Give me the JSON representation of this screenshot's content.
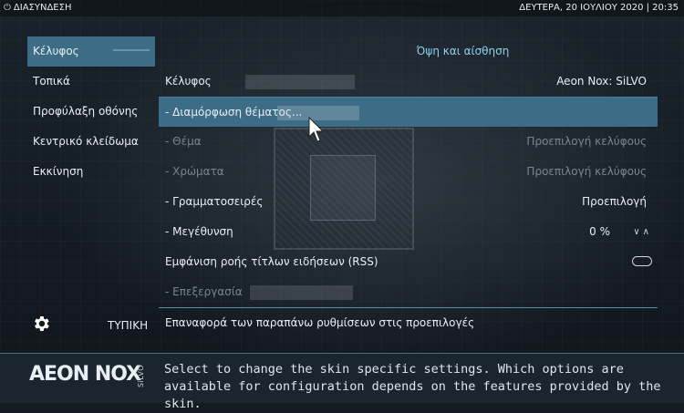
{
  "topbar": {
    "left_label": "ΔΙΑΣΥΝΔΕΣΗ",
    "datetime": "ΔΕΥΤΕΡΑ, 20 ΙΟΥΛΙΟΥ 2020 | 20:35"
  },
  "menu": {
    "items": [
      {
        "label": "Κέλυφος",
        "active": true
      },
      {
        "label": "Τοπικά"
      },
      {
        "label": "Προφύλαξη οθόνης"
      },
      {
        "label": "Κεντρικό κλείδωμα"
      },
      {
        "label": "Εκκίνηση"
      }
    ]
  },
  "panel": {
    "title": "Όψη και αίσθηση",
    "rows": [
      {
        "label": "Κέλυφος",
        "value": "Aeon Nox: SiLVO"
      },
      {
        "label": "- Διαμόρφωση θέματος..."
      },
      {
        "label": "- Θέμα",
        "value": "Προεπιλογή κελύφους"
      },
      {
        "label": "- Χρώματα",
        "value": "Προεπιλογή κελύφους"
      },
      {
        "label": "- Γραμματοσειρές",
        "value": "Προεπιλογή"
      },
      {
        "label": "- Μεγέθυνση",
        "value": "0 %",
        "arrows": "∨∧"
      },
      {
        "label": "Εμφάνιση ροής τίτλων ειδήσεων (RSS)"
      },
      {
        "label": "- Επεξεργασία"
      }
    ],
    "reset_label": "Επαναφορά των παραπάνω ρυθμίσεων στις προεπιλογές"
  },
  "bottom_left": {
    "icon": "gear-icon",
    "level_label": "ΤΥΠΙΚΗ"
  },
  "footer": {
    "logo": "AEON NOX",
    "logo_sub": "SiLVO",
    "help_text": "Select to change the skin specific settings. Which options are available for configuration depends on the features provided by the skin."
  },
  "colors": {
    "accent": "#3d6c86",
    "title": "#8fd0ee",
    "disabled": "#7c848b"
  }
}
